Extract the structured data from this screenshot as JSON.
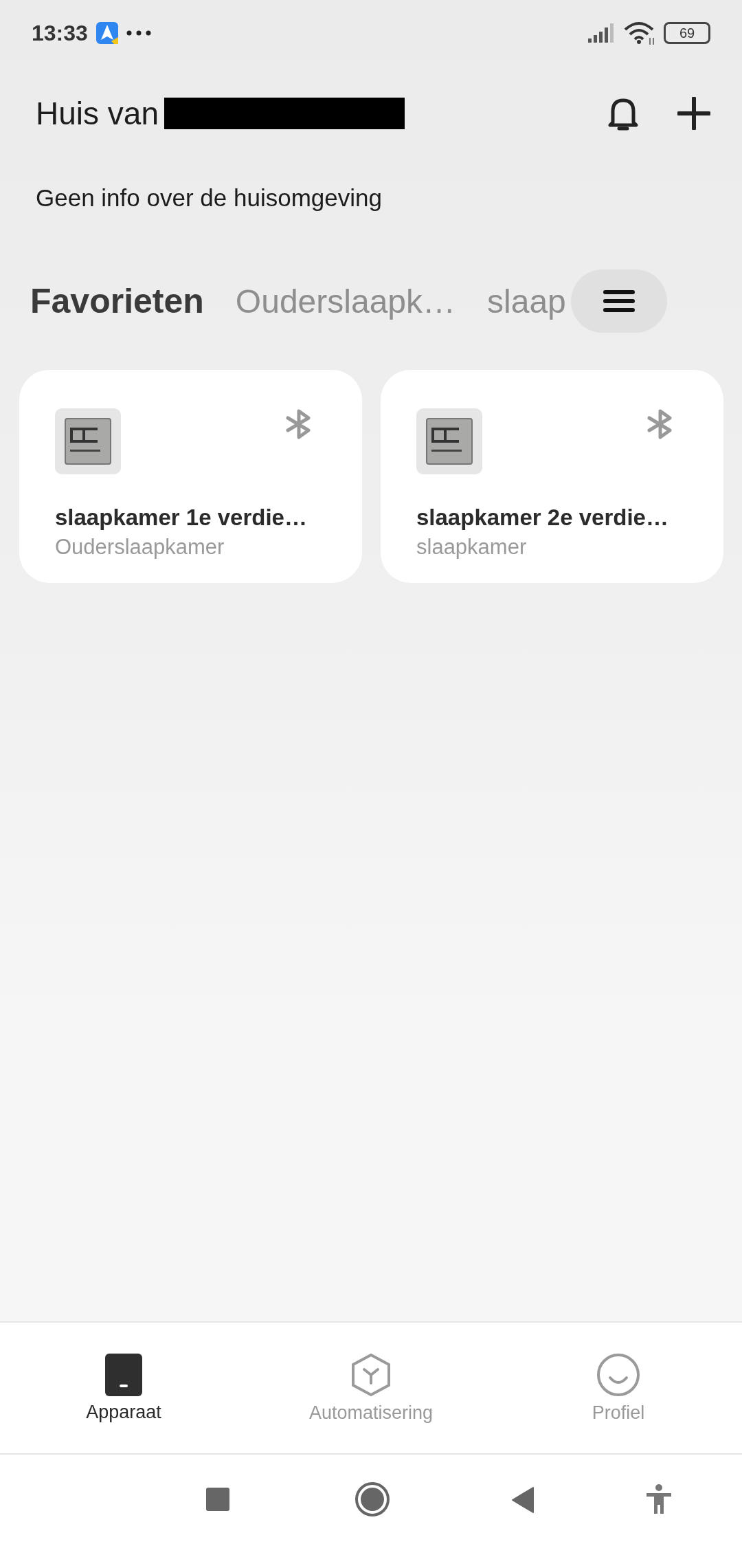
{
  "status_bar": {
    "time": "13:33",
    "battery": "69"
  },
  "header": {
    "title": "Huis van",
    "subtitle": "Geen info over de huisomgeving"
  },
  "tabs": [
    {
      "label": "Favorieten",
      "selected": true
    },
    {
      "label": "Ouderslaapk…",
      "selected": false
    },
    {
      "label": "slaap",
      "selected": false
    }
  ],
  "devices": [
    {
      "name": "slaapkamer 1e verdie…",
      "room": "Ouderslaapkamer"
    },
    {
      "name": "slaapkamer 2e verdie…",
      "room": "slaapkamer"
    }
  ],
  "bottom_nav": [
    {
      "label": "Apparaat",
      "kind": "device",
      "selected": true
    },
    {
      "label": "Automatisering",
      "kind": "automation",
      "selected": false
    },
    {
      "label": "Profiel",
      "kind": "profile",
      "selected": false
    }
  ]
}
